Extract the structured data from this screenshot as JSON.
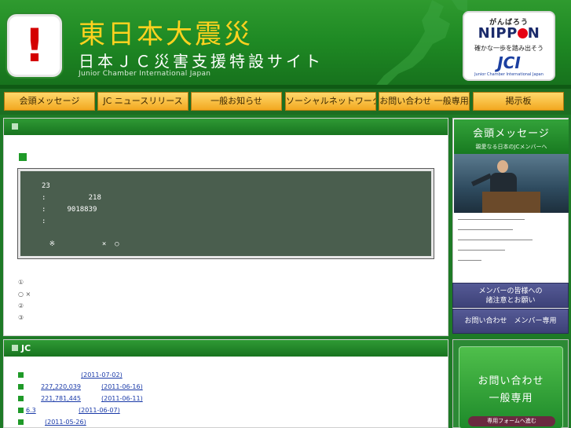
{
  "header": {
    "title_jp": "東日本大震災",
    "subtitle_jp": "日本ＪＣ災害支援特設サイト",
    "subtitle_en": "Junior Chamber International Japan",
    "alert_glyph": "!",
    "badge": {
      "top": "がんばろう",
      "nippon_left": "NIPP",
      "nippon_right": "N",
      "tagline": "確かな一歩を踏み出そう",
      "jci": "JCI",
      "jci_sub": "Junior Chamber International Japan"
    }
  },
  "nav": {
    "items": [
      {
        "label": "会頭メッセージ"
      },
      {
        "label": "JC ニュースリリース"
      },
      {
        "label": "一般お知らせ"
      },
      {
        "label": "ソーシャルネットワーク"
      },
      {
        "label": "お問い合わせ 一般専用"
      },
      {
        "label": "掲示板"
      }
    ]
  },
  "main": {
    "board_lines": [
      "23",
      ":          218",
      ":     9018839",
      ":",
      "",
      "    ※           ×  ○"
    ],
    "notes": [
      "①",
      "  ○   ×",
      "②",
      "③"
    ]
  },
  "news": {
    "header": "JC",
    "items": [
      {
        "prefix": "",
        "date": "(2011-07-02)"
      },
      {
        "prefix": "227,220,039",
        "date": "(2011-06-16)"
      },
      {
        "prefix": "221,781,445",
        "date": "(2011-06-11)"
      },
      {
        "prefix": "6.3",
        "date": "(2011-06-07)"
      },
      {
        "prefix": "",
        "date": "(2011-05-26)"
      }
    ]
  },
  "sidebar": {
    "message_title": "会頭メッセージ",
    "message_sub": "親愛なる日本のJCメンバーへ",
    "member_notice": [
      "メンバーの皆様への",
      "諸注意とお願い"
    ],
    "member_contact": "お問い合わせ　メンバー専用",
    "contact_line1": "お問い合わせ",
    "contact_line2": "一般専用",
    "contact_button": "専用フォームへ進む"
  },
  "colors": {
    "brand_green": "#1f8a24",
    "title_yellow": "#ffd21f",
    "nav_orange": "#f2a820",
    "chalkboard": "#4a5e4e",
    "alert_red": "#d40000",
    "link_blue": "#1a3aa8"
  }
}
